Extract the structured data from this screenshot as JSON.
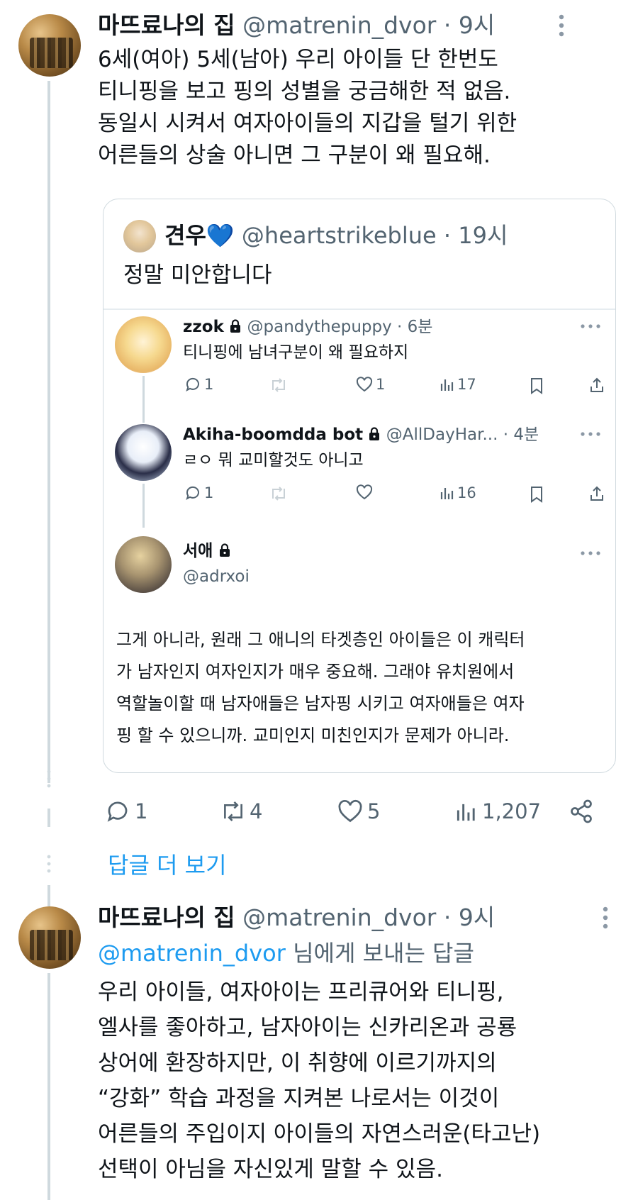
{
  "tweet1": {
    "name": "마뜨료나의 집",
    "handle": "@matrenin_dvor",
    "time": "· 9시",
    "lines": [
      "6세(여아) 5세(남아) 우리 아이들 단 한번도",
      "티니핑을 보고 핑의 성별을 궁금해한 적 없음.",
      "동일시 시켜서 여자아이들의 지갑을 털기 위한",
      "어른들의 상술 아니면 그 구분이 왜 필요해."
    ],
    "quote": {
      "name": "견우💙",
      "handle": "@heartstrikeblue",
      "time": "· 19시",
      "text": "정말 미안합니다",
      "replies": [
        {
          "name": "zzok",
          "handle": "@pandythepuppy",
          "time": "· 6분",
          "text": "티니핑에 남녀구분이 왜 필요하지",
          "reply_count": "1",
          "like_count": "1",
          "view_count": "17"
        },
        {
          "name": "Akiha-boomdda bot",
          "handle": "@AllDayHar...",
          "time": "· 4분",
          "text": "ㄹㅇ 뭐 교미할것도 아니고",
          "reply_count": "1",
          "like_count": "",
          "view_count": "16"
        }
      ],
      "main_reply": {
        "name": "서애",
        "handle": "@adrxoi",
        "lines": [
          "그게 아니라, 원래 그 애니의 타겟층인 아이들은 이 캐릭터",
          "가 남자인지 여자인지가 매우 중요해. 그래야 유치원에서",
          "역할놀이할 때 남자애들은 남자핑 시키고 여자애들은 여자",
          "핑 할 수 있으니까. 교미인지 미친인지가 문제가 아니라."
        ]
      }
    },
    "stats": {
      "replies": "1",
      "retweets": "4",
      "likes": "5",
      "views": "1,207"
    }
  },
  "more_replies": "답글 더 보기",
  "tweet2": {
    "name": "마뜨료나의 집",
    "handle": "@matrenin_dvor",
    "time": "· 9시",
    "reply_to_handle": "@matrenin_dvor",
    "reply_to_suffix": " 님에게 보내는 답글",
    "lines": [
      "우리 아이들, 여자아이는 프리큐어와 티니핑,",
      "엘사를 좋아하고, 남자아이는 신카리온과 공룡",
      "상어에 환장하지만, 이 취향에 이르기까지의",
      "“강화” 학습 과정을 지켜본 나로서는 이것이",
      "어른들의 주입이지 아이들의 자연스러운(타고난)",
      "선택이 아님을 자신있게 말할 수 있음."
    ]
  },
  "colors": {
    "accent": "#1d9bf0",
    "muted": "#536471",
    "border": "#cfd9de"
  }
}
